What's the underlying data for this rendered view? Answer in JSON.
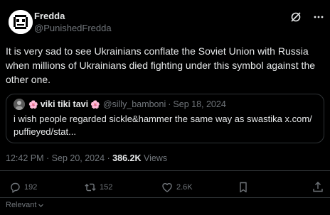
{
  "author": {
    "display_name": "Fredda",
    "handle": "@PunishedFredda"
  },
  "header_icons": [
    "grok-icon",
    "more-icon"
  ],
  "tweet": {
    "text": "It is very sad to see Ukrainians conflate the Soviet Union with Russia when millions of Ukrainians died fighting under this symbol against the other one."
  },
  "quote": {
    "flower_left": "🌸",
    "display_name": "viki tiki tavi",
    "flower_right": "🌸",
    "handle": "@silly_bamboni",
    "separator": "·",
    "date": "Sep 18, 2024",
    "text": "i wish people regarded sickle&hammer the same way as swastika x.com/\npuffieyed/stat..."
  },
  "meta": {
    "time": "12:42 PM",
    "separator": "·",
    "date": "Sep 20, 2024",
    "dot": "·",
    "views_count": "386.2K",
    "views_label": "Views"
  },
  "actions": {
    "replies": "192",
    "reposts": "152",
    "likes": "2.6K"
  },
  "sort": {
    "label": "Relevant"
  },
  "colors": {
    "background": "#000000",
    "text": "#e7e9ea",
    "muted": "#71767b",
    "border": "#2f3336"
  }
}
